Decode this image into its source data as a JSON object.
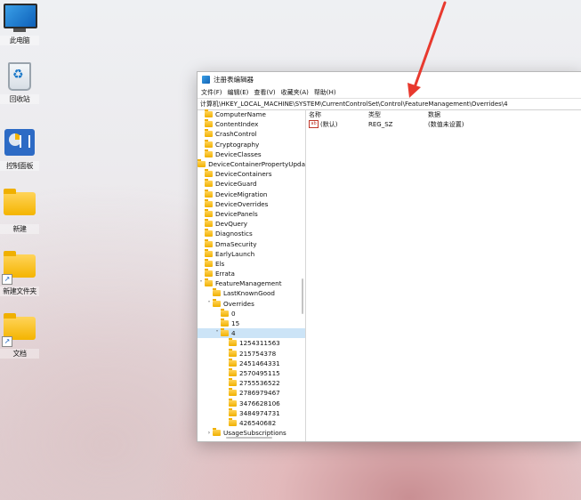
{
  "desktop": {
    "icons": [
      {
        "label": "此电脑",
        "icon": "monitor-icon"
      },
      {
        "label": "回收站",
        "icon": "recycle-bin-icon"
      },
      {
        "label": "控制面板",
        "icon": "control-panel-icon"
      },
      {
        "label": "新建",
        "icon": "folder-icon"
      },
      {
        "label": "新建文件夹",
        "icon": "folder-shortcut-icon"
      },
      {
        "label": "文档",
        "icon": "folder-shortcut-icon"
      }
    ]
  },
  "window": {
    "title": "注册表编辑器",
    "menu": [
      "文件(F)",
      "编辑(E)",
      "查看(V)",
      "收藏夹(A)",
      "帮助(H)"
    ],
    "address": "计算机\\HKEY_LOCAL_MACHINE\\SYSTEM\\CurrentControlSet\\Control\\FeatureManagement\\Overrides\\4",
    "tree": [
      {
        "label": "ComputerName",
        "indent": 0,
        "arrow": ""
      },
      {
        "label": "ContentIndex",
        "indent": 0,
        "arrow": ""
      },
      {
        "label": "CrashControl",
        "indent": 0,
        "arrow": ""
      },
      {
        "label": "Cryptography",
        "indent": 0,
        "arrow": ""
      },
      {
        "label": "DeviceClasses",
        "indent": 0,
        "arrow": ""
      },
      {
        "label": "DeviceContainerPropertyUpda",
        "indent": 0,
        "arrow": ""
      },
      {
        "label": "DeviceContainers",
        "indent": 0,
        "arrow": ""
      },
      {
        "label": "DeviceGuard",
        "indent": 0,
        "arrow": ""
      },
      {
        "label": "DeviceMigration",
        "indent": 0,
        "arrow": ""
      },
      {
        "label": "DeviceOverrides",
        "indent": 0,
        "arrow": ""
      },
      {
        "label": "DevicePanels",
        "indent": 0,
        "arrow": ""
      },
      {
        "label": "DevQuery",
        "indent": 0,
        "arrow": ""
      },
      {
        "label": "Diagnostics",
        "indent": 0,
        "arrow": ""
      },
      {
        "label": "DmaSecurity",
        "indent": 0,
        "arrow": ""
      },
      {
        "label": "EarlyLaunch",
        "indent": 0,
        "arrow": ""
      },
      {
        "label": "Els",
        "indent": 0,
        "arrow": ""
      },
      {
        "label": "Errata",
        "indent": 0,
        "arrow": ""
      },
      {
        "label": "FeatureManagement",
        "indent": 0,
        "arrow": "v"
      },
      {
        "label": "LastKnownGood",
        "indent": 1,
        "arrow": ""
      },
      {
        "label": "Overrides",
        "indent": 1,
        "arrow": "v"
      },
      {
        "label": "0",
        "indent": 2,
        "arrow": ""
      },
      {
        "label": "15",
        "indent": 2,
        "arrow": ""
      },
      {
        "label": "4",
        "indent": 2,
        "arrow": "v",
        "selected": true
      },
      {
        "label": "1254311563",
        "indent": 3,
        "arrow": ""
      },
      {
        "label": "215754378",
        "indent": 3,
        "arrow": ""
      },
      {
        "label": "2451464331",
        "indent": 3,
        "arrow": ""
      },
      {
        "label": "2570495115",
        "indent": 3,
        "arrow": ""
      },
      {
        "label": "2755536522",
        "indent": 3,
        "arrow": ""
      },
      {
        "label": "2786979467",
        "indent": 3,
        "arrow": ""
      },
      {
        "label": "3476628106",
        "indent": 3,
        "arrow": ""
      },
      {
        "label": "3484974731",
        "indent": 3,
        "arrow": ""
      },
      {
        "label": "426540682",
        "indent": 3,
        "arrow": ""
      },
      {
        "label": "UsageSubscriptions",
        "indent": 1,
        "arrow": ">"
      }
    ],
    "columns": {
      "name": "名称",
      "type": "类型",
      "data": "数据"
    },
    "values": [
      {
        "name": "(默认)",
        "type": "REG_SZ",
        "data": "(数值未设置)"
      }
    ]
  },
  "colors": {
    "arrow": "#e8392e",
    "selection": "#cce4f7",
    "folder": "#f4b400"
  }
}
